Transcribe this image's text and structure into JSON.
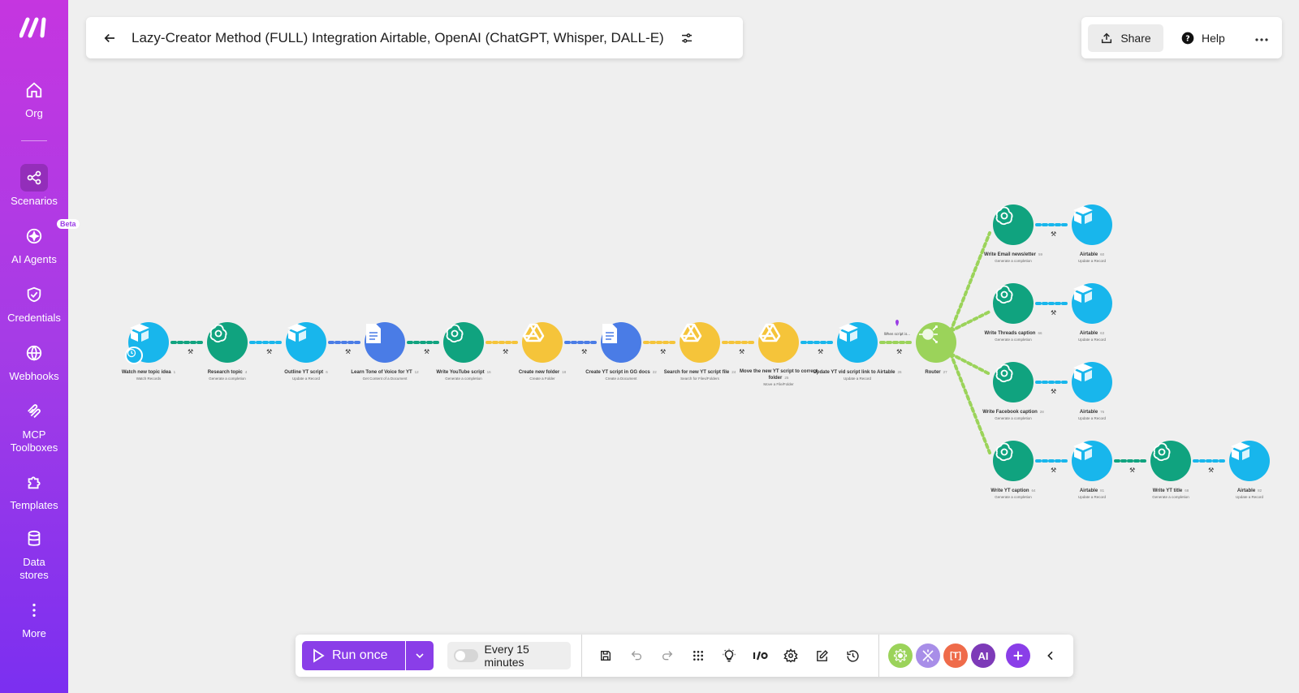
{
  "sidebar": {
    "items": [
      {
        "label": "Org",
        "icon": "home-icon"
      },
      {
        "label": "Scenarios",
        "icon": "share-nodes-icon"
      },
      {
        "label": "AI Agents",
        "icon": "ai-sparkle-icon",
        "badge": "Beta"
      },
      {
        "label": "Credentials",
        "icon": "shield-check-icon"
      },
      {
        "label": "Webhooks",
        "icon": "globe-icon"
      },
      {
        "label": "MCP Toolboxes",
        "icon": "mcp-icon"
      },
      {
        "label": "Templates",
        "icon": "puzzle-icon"
      },
      {
        "label": "Data stores",
        "icon": "database-icon"
      },
      {
        "label": "More",
        "icon": "kebab-icon"
      }
    ],
    "active": "Scenarios"
  },
  "header": {
    "title": "Lazy-Creator Method (FULL) Integration Airtable, OpenAI (ChatGPT, Whisper, DALL-E)"
  },
  "topright": {
    "share_label": "Share",
    "help_label": "Help"
  },
  "scenario": {
    "main_nodes": [
      {
        "name": "Watch new topic idea",
        "num": "1",
        "sub": "Watch Records",
        "app": "airtable"
      },
      {
        "name": "Research topic",
        "num": "4",
        "sub": "Generate a completion",
        "app": "openai"
      },
      {
        "name": "Outline YT script",
        "num": "6",
        "sub": "Update a Record",
        "app": "airtable"
      },
      {
        "name": "Learn Tone of Voice for YT",
        "num": "12",
        "sub": "Get Content of a Document",
        "app": "gdocs"
      },
      {
        "name": "Write YouTube script",
        "num": "16",
        "sub": "Generate a completion",
        "app": "openai"
      },
      {
        "name": "Create new folder",
        "num": "18",
        "sub": "Create a Folder",
        "app": "gdrive"
      },
      {
        "name": "Create YT script in GG docs",
        "num": "22",
        "sub": "Create a Document",
        "app": "gdocs"
      },
      {
        "name": "Search for new YT script file",
        "num": "24",
        "sub": "Search for Files/Folders",
        "app": "gdrive"
      },
      {
        "name": "Move the new YT script to correct folder",
        "num": "25",
        "sub": "Move a File/Folder",
        "app": "gdrive"
      },
      {
        "name": "Update YT vid script link to Airtable",
        "num": "26",
        "sub": "Update a Record",
        "app": "airtable"
      },
      {
        "name": "Router",
        "num": "27",
        "sub": "",
        "app": "router"
      }
    ],
    "filter_label": "When script is...",
    "branches": [
      [
        {
          "name": "Write Email newsletter",
          "num": "59",
          "sub": "Generate a completion",
          "app": "openai"
        },
        {
          "name": "Airtable",
          "num": "60",
          "sub": "Update a Record",
          "app": "airtable"
        }
      ],
      [
        {
          "name": "Write Threads caption",
          "num": "66",
          "sub": "Generate a completion",
          "app": "openai"
        },
        {
          "name": "Airtable",
          "num": "63",
          "sub": "Update a Record",
          "app": "airtable"
        }
      ],
      [
        {
          "name": "Write Facebook caption",
          "num": "28",
          "sub": "Generate a completion",
          "app": "openai"
        },
        {
          "name": "Airtable",
          "num": "76",
          "sub": "Update a Record",
          "app": "airtable"
        }
      ],
      [
        {
          "name": "Write YT caption",
          "num": "64",
          "sub": "Generate a completion",
          "app": "openai"
        },
        {
          "name": "Airtable",
          "num": "81",
          "sub": "Update a Record",
          "app": "airtable"
        },
        {
          "name": "Write YT title",
          "num": "68",
          "sub": "Generate a completion",
          "app": "openai"
        },
        {
          "name": "Airtable",
          "num": "82",
          "sub": "Update a Record",
          "app": "airtable"
        }
      ]
    ]
  },
  "toolbar": {
    "run_label": "Run once",
    "schedule_label": "Every 15 minutes",
    "ai_label": "AI"
  },
  "colors": {
    "openai": "#10a37f",
    "airtable": "#18b6ec",
    "gdocs": "#4a7ce6",
    "gdrive": "#f5c43a",
    "router": "#9bd35a",
    "accent": "#8a3ee8"
  }
}
